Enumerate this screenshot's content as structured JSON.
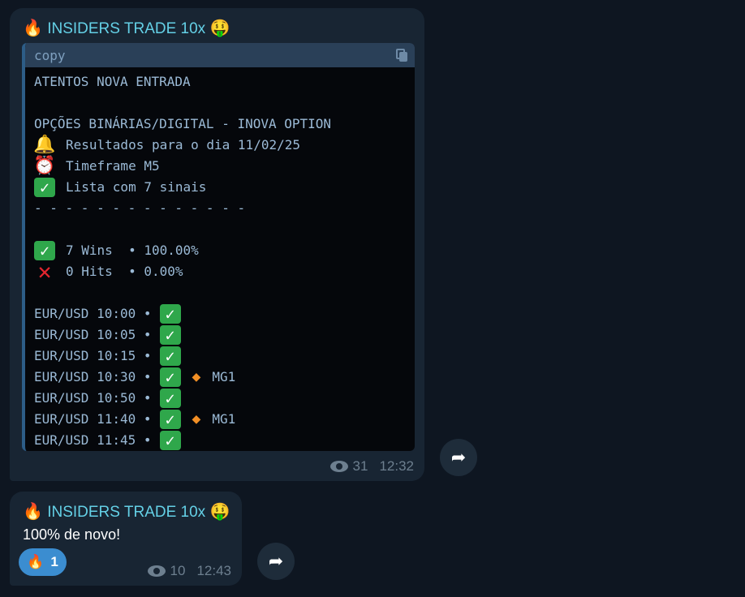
{
  "messages": [
    {
      "sender": "INSIDERS TRADE 10x",
      "sender_prefix_emoji": "🔥",
      "sender_suffix_emoji": "🤑",
      "code_block": {
        "language": "copy",
        "lines": [
          {
            "icon": "",
            "text": "ATENTOS NOVA ENTRADA"
          },
          {
            "icon": "",
            "text": ""
          },
          {
            "icon": "",
            "text": "OPÇÕES BINÁRIAS/DIGITAL - INOVA OPTION"
          },
          {
            "icon": "🔔",
            "text": "Resultados para o dia 11/02/25"
          },
          {
            "icon": "⏰",
            "text": "Timeframe M5"
          },
          {
            "icon": "✅",
            "text": "Lista com 7 sinais"
          },
          {
            "icon": "",
            "text": "- - - - - - - - - - - - - -"
          },
          {
            "icon": "",
            "text": ""
          },
          {
            "icon": "✅",
            "text": "7 Wins  • 100.00%"
          },
          {
            "icon": "❌",
            "text": "0 Hits  • 0.00%"
          },
          {
            "icon": "",
            "text": ""
          }
        ],
        "signals": [
          {
            "text": "EUR/USD 10:00 •",
            "result": "✅",
            "note": ""
          },
          {
            "text": "EUR/USD 10:05 •",
            "result": "✅",
            "note": ""
          },
          {
            "text": "EUR/USD 10:15 •",
            "result": "✅",
            "note": ""
          },
          {
            "text": "EUR/USD 10:30 •",
            "result": "✅",
            "note": "MG1"
          },
          {
            "text": "EUR/USD 10:50 •",
            "result": "✅",
            "note": ""
          },
          {
            "text": "EUR/USD 11:40 •",
            "result": "✅",
            "note": "MG1"
          },
          {
            "text": "EUR/USD 11:45 •",
            "result": "✅",
            "note": ""
          }
        ]
      },
      "views": "31",
      "time": "12:32"
    },
    {
      "sender": "INSIDERS TRADE 10x",
      "sender_prefix_emoji": "🔥",
      "sender_suffix_emoji": "🤑",
      "text": "100% de novo!",
      "reaction": {
        "emoji": "🔥",
        "count": "1"
      },
      "views": "10",
      "time": "12:43"
    }
  ],
  "colors": {
    "background": "#0e1621",
    "bubble": "#182533",
    "sender": "#64d0e6",
    "code_text": "#9bbad6",
    "reaction": "#3b8dd0"
  }
}
